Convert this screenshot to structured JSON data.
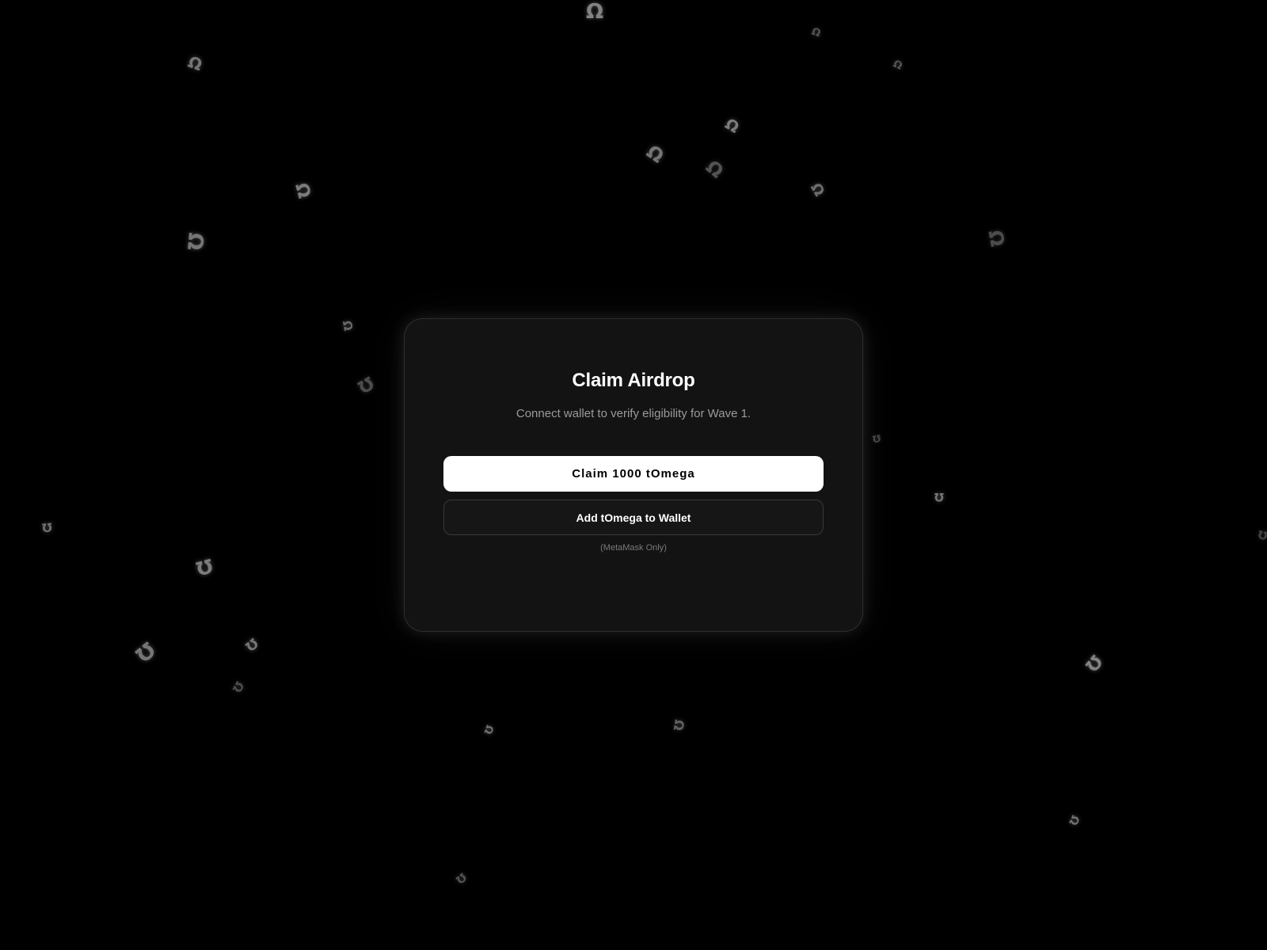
{
  "background": {
    "color": "#000000",
    "symbol_glyph": "Ω",
    "symbol_color": "#8a8a8a"
  },
  "card": {
    "title": "Claim Airdrop",
    "subtitle": "Connect wallet to verify eligibility for Wave 1.",
    "claim_button_label": "Claim 1000 tOmega",
    "add_token_button_label": "Add tOmega to Wallet",
    "note": "(MetaMask Only)"
  },
  "colors": {
    "card_background": "#131313",
    "primary_button": "#ffffff",
    "primary_button_text": "#000000",
    "secondary_button_text": "#ffffff",
    "muted_text": "#9a9a9a"
  }
}
